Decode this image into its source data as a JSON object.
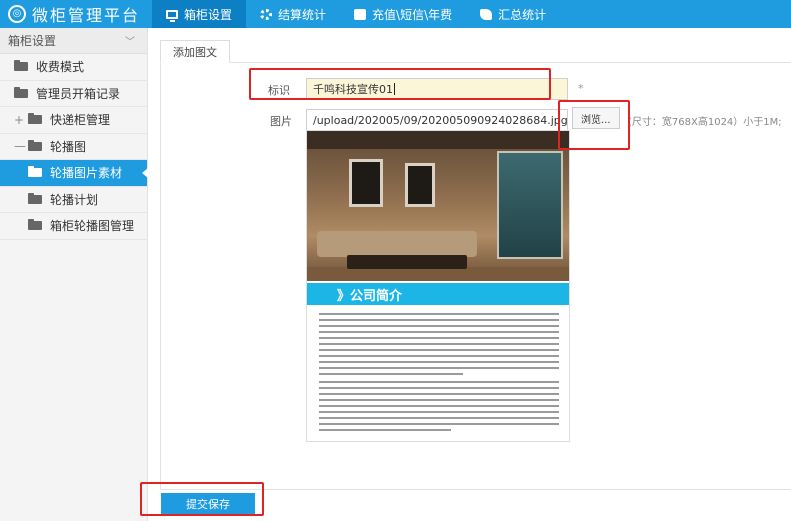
{
  "app": {
    "title": "微柜管理平台"
  },
  "topnav": [
    {
      "label": "箱柜设置",
      "icon": "monitor-icon",
      "active": true
    },
    {
      "label": "结算统计",
      "icon": "gear-icon",
      "active": false
    },
    {
      "label": "充值\\短信\\年费",
      "icon": "cash-icon",
      "active": false
    },
    {
      "label": "汇总统计",
      "icon": "puzzle-icon",
      "active": false
    }
  ],
  "sidebar": {
    "header": "箱柜设置",
    "items": [
      {
        "label": "收费模式"
      },
      {
        "label": "管理员开箱记录"
      },
      {
        "label": "快递柜管理",
        "toggle": "+"
      },
      {
        "label": "轮播图",
        "toggle": "—"
      },
      {
        "label": "轮播图片素材",
        "active": true
      },
      {
        "label": "轮播计划"
      },
      {
        "label": "箱柜轮播图管理"
      }
    ]
  },
  "main": {
    "tab": "添加图文",
    "form": {
      "title_label": "标识",
      "title_value": "千鸣科技宣传01",
      "required_mark": "*",
      "image_label": "图片",
      "image_path": "/upload/202005/09/202005090924028684.jpg",
      "browse_label": "浏览...",
      "hint": "(尺寸：宽768X高1024）小于1M;"
    },
    "preview": {
      "banner": "》公司简介"
    },
    "submit_label": "提交保存"
  },
  "colors": {
    "primary": "#1f9be0",
    "primary_dark": "#0d7fc4",
    "highlight": "#e02424",
    "banner": "#1cb6e6"
  }
}
